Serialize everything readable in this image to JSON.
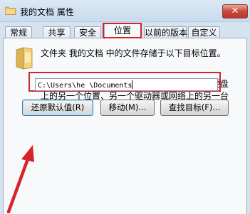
{
  "window": {
    "title": "我的文档 属性",
    "close_label": "✕"
  },
  "tabs": [
    {
      "label": "常规",
      "active": false
    },
    {
      "label": "共享",
      "active": false
    },
    {
      "label": "安全",
      "active": false
    },
    {
      "label": "位置",
      "active": true
    },
    {
      "label": "以前的版本",
      "active": false
    },
    {
      "label": "自定义",
      "active": false
    }
  ],
  "location": {
    "folder_icon": "folder-icon",
    "target_text": "文件夹 我的文档 中的文件存储于以下目标位置。",
    "description": "您可以将此文件夹中文件存储的位置更改为此硬盘上的另一个位置、另一个驱动器或网络上的另一台计算机。",
    "path_value": "C:\\Users\\he          \\Documents"
  },
  "buttons": {
    "restore_default": "还原默认值(R)",
    "move": "移动(M)...",
    "find_target": "查找目标(F)..."
  },
  "colors": {
    "highlight": "#d5242b",
    "titlebar": "#d5e3f0"
  }
}
